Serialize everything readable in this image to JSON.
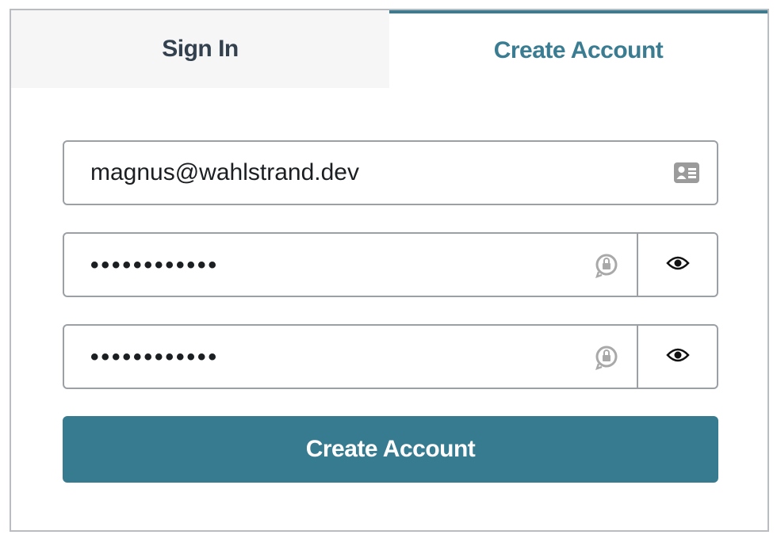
{
  "tabs": {
    "sign_in": "Sign In",
    "create_account": "Create Account",
    "active": "create_account"
  },
  "form": {
    "email": {
      "value": "magnus@wahlstrand.dev",
      "icon": "contact-card-icon"
    },
    "password": {
      "value": "••••••••••••",
      "icon": "password-generator-icon",
      "toggle_icon": "eye-icon"
    },
    "confirm_password": {
      "value": "••••••••••••",
      "icon": "password-generator-icon",
      "toggle_icon": "eye-icon"
    },
    "submit_label": "Create Account"
  },
  "colors": {
    "accent": "#377b91",
    "inactive_tab_bg": "#f6f6f7",
    "inactive_tab_text": "#33414f",
    "border": "#9aa0a6"
  }
}
